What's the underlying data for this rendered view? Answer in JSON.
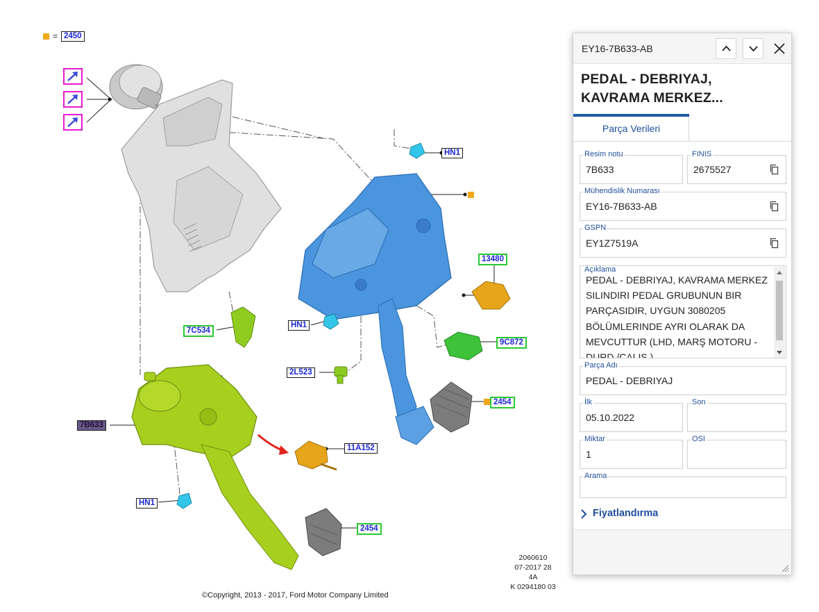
{
  "diagram": {
    "legend_value": "2450",
    "legend_eq": "=",
    "copyright": "©Copyright, 2013 - 2017, Ford Motor Company Limited",
    "ref_lines": [
      "2060610",
      "07-2017 28",
      "4A",
      "K 0294180 03"
    ],
    "callouts": [
      {
        "id": "hn1-top",
        "text": "HN1"
      },
      {
        "id": "13480",
        "text": "13480"
      },
      {
        "id": "hn1-mid",
        "text": "HN1"
      },
      {
        "id": "9c872",
        "text": "9C872"
      },
      {
        "id": "7c534",
        "text": "7C534"
      },
      {
        "id": "2l523",
        "text": "2L523"
      },
      {
        "id": "2454-right",
        "text": "2454"
      },
      {
        "id": "7b633",
        "text": "7B633"
      },
      {
        "id": "11a152",
        "text": "11A152"
      },
      {
        "id": "hn1-bottom",
        "text": "HN1"
      },
      {
        "id": "2454-bottom",
        "text": "2454"
      }
    ],
    "colors": {
      "marker": "#f0a818",
      "hand_icon": "#e81ad0",
      "bracket_blue": "#4a95de",
      "pedal_green": "#a7cf1e"
    }
  },
  "panel": {
    "header_title": "EY16-7B633-AB",
    "title": "PEDAL - DEBRIYAJ, KAVRAMA MERKEZ...",
    "tab_label": "Parça Verileri",
    "fields": {
      "resim_notu": {
        "label": "Resim notu",
        "value": "7B633"
      },
      "finis": {
        "label": "FINIS",
        "value": "2675527"
      },
      "muhendislik": {
        "label": "Mühendislik Numarası",
        "value": "EY16-7B633-AB"
      },
      "gspn": {
        "label": "GSPN",
        "value": "EY1Z7519A"
      },
      "aciklama": {
        "label": "Açıklama",
        "value": "PEDAL - DEBRIYAJ, KAVRAMA MERKEZ SILINDIRI PEDAL GRUBUNUN BIR PARÇASIDIR, UYGUN 3080205 BÖLÜMLERINDE AYRI OLARAK DA MEVCUTTUR (LHD, MARŞ MOTORU - DURD./ÇALIŞ.)"
      },
      "parca_adi": {
        "label": "Parça Adı",
        "value": "PEDAL - DEBRIYAJ"
      },
      "ilk": {
        "label": "İlk",
        "value": "05.10.2022"
      },
      "son": {
        "label": "Son",
        "value": ""
      },
      "miktar": {
        "label": "Miktar",
        "value": "1"
      },
      "osi": {
        "label": "OSI",
        "value": ""
      },
      "arama": {
        "label": "Arama",
        "value": ""
      }
    },
    "pricing_label": "Fiyatlandırma",
    "accent_color": "#1f57a9",
    "label_color": "#1f4e9c"
  }
}
